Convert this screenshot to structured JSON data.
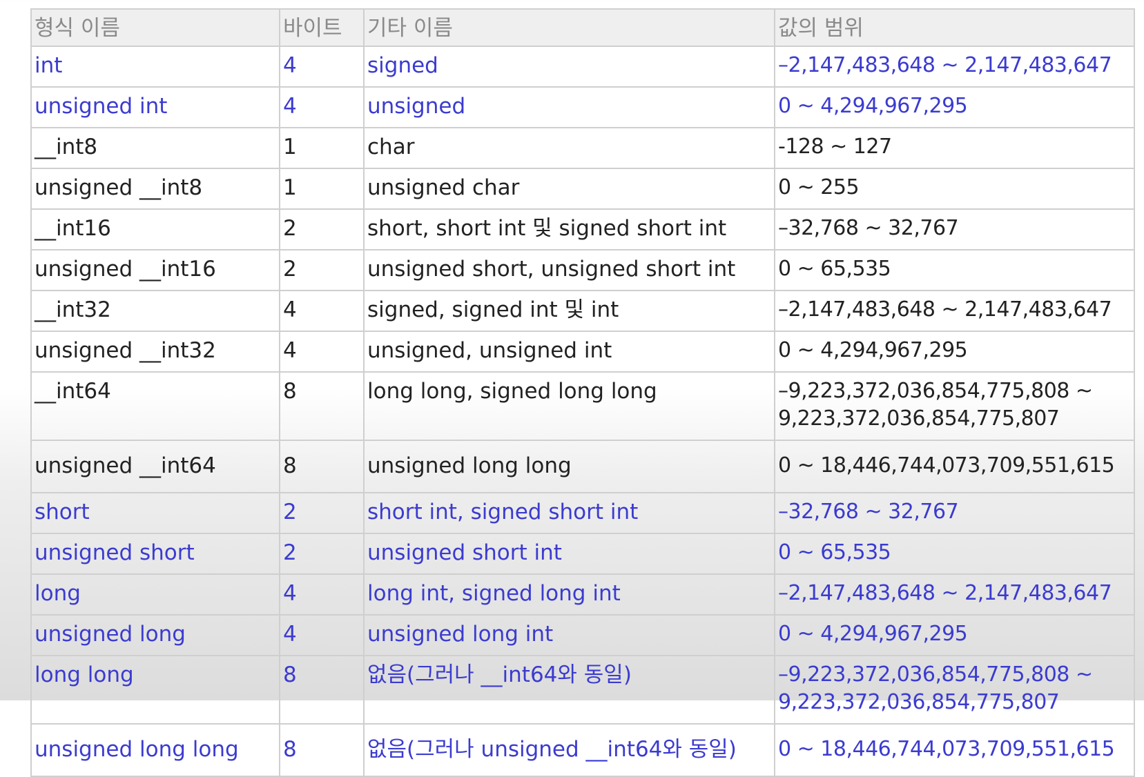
{
  "table": {
    "headers": [
      "형식 이름",
      "바이트",
      "기타 이름",
      "값의 범위"
    ],
    "rows": [
      {
        "name": "int",
        "bytes": "4",
        "other": "signed",
        "range": "–2,147,483,648 ~ 2,147,483,647",
        "highlight": true
      },
      {
        "name": "unsigned int",
        "bytes": "4",
        "other": "unsigned",
        "range": "0 ~ 4,294,967,295",
        "highlight": true
      },
      {
        "name": "__int8",
        "bytes": "1",
        "other": "char",
        "range": "-128 ~ 127",
        "highlight": false
      },
      {
        "name": "unsigned __int8",
        "bytes": "1",
        "other": "unsigned char",
        "range": "0 ~ 255",
        "highlight": false
      },
      {
        "name": "__int16",
        "bytes": "2",
        "other": "short, short int 및 signed short int",
        "range": "–32,768 ~ 32,767",
        "highlight": false
      },
      {
        "name": "unsigned __int16",
        "bytes": "2",
        "other": "unsigned short, unsigned short int",
        "range": "0 ~ 65,535",
        "highlight": false
      },
      {
        "name": "__int32",
        "bytes": "4",
        "other": "signed, signed int 및 int",
        "range": "–2,147,483,648 ~ 2,147,483,647",
        "highlight": false
      },
      {
        "name": "unsigned __int32",
        "bytes": "4",
        "other": "unsigned, unsigned int",
        "range": "0 ~ 4,294,967,295",
        "highlight": false
      },
      {
        "name": "__int64",
        "bytes": "8",
        "other": "long long, signed long long",
        "range": "–9,223,372,036,854,775,808 ~ 9,223,372,036,854,775,807",
        "highlight": false
      },
      {
        "name": "unsigned __int64",
        "bytes": "8",
        "other": "unsigned long long",
        "range": "0 ~ 18,446,744,073,709,551,615",
        "highlight": false
      },
      {
        "name": "short",
        "bytes": "2",
        "other": "short int, signed short int",
        "range": "–32,768 ~ 32,767",
        "highlight": true
      },
      {
        "name": "unsigned short",
        "bytes": "2",
        "other": "unsigned short int",
        "range": "0 ~ 65,535",
        "highlight": true
      },
      {
        "name": "long",
        "bytes": "4",
        "other": "long int, signed long int",
        "range": "–2,147,483,648 ~ 2,147,483,647",
        "highlight": true
      },
      {
        "name": "unsigned long",
        "bytes": "4",
        "other": "unsigned long int",
        "range": "0 ~ 4,294,967,295",
        "highlight": true
      },
      {
        "name": "long long",
        "bytes": "8",
        "other": "없음(그러나 __int64와 동일)",
        "range": "–9,223,372,036,854,775,808 ~ 9,223,372,036,854,775,807",
        "highlight": true
      },
      {
        "name": "unsigned long long",
        "bytes": "8",
        "other": "없음(그러나 unsigned __int64와 동일)",
        "range": "0 ~ 18,446,744,073,709,551,615",
        "highlight": true
      }
    ]
  }
}
